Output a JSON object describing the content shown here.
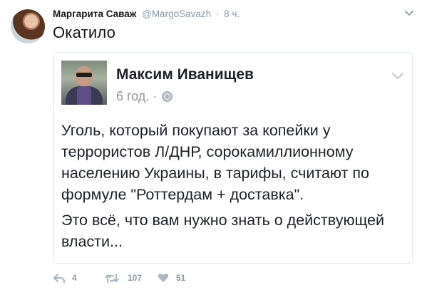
{
  "tweet": {
    "author_name": "Маргарита Саваж",
    "author_handle": "@MargoSavazh",
    "separator": "·",
    "time": "8 ч.",
    "text": "Окатило"
  },
  "embedded_post": {
    "author_name": "Максим Иванищев",
    "time": "6 год.",
    "separator": "·",
    "paragraphs": [
      "Уголь, который покупают за копейки у террористов Л/ДНР, сорокамиллионному населению Украины, в тарифы, считают по формуле \"Роттердам + доставка\".",
      "Это всё, что вам нужно знать о действующей власти..."
    ]
  },
  "actions": {
    "reply_count": "4",
    "retweet_count": "107",
    "like_count": "51"
  },
  "colors": {
    "text": "#14171a",
    "muted": "#8899a6",
    "border": "#e1e8ed",
    "fb_text": "#1d2129",
    "fb_muted": "#90949c"
  },
  "icons": [
    "chevron-down-icon",
    "globe-icon",
    "reply-icon",
    "retweet-icon",
    "heart-icon"
  ]
}
